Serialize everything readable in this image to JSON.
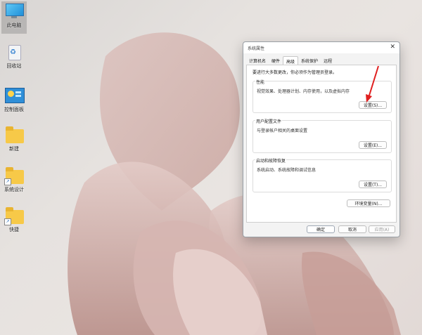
{
  "desktop": {
    "icons": [
      {
        "label": "此电脑"
      },
      {
        "label": "回收站"
      },
      {
        "label": "控制面板"
      },
      {
        "label": "新建"
      },
      {
        "label": "系统设计"
      },
      {
        "label": "快捷"
      }
    ]
  },
  "dialog": {
    "title": "系统属性",
    "close_glyph": "✕",
    "tabs": [
      "计算机名",
      "硬件",
      "高级",
      "系统保护",
      "远程"
    ],
    "active_tab": "高级",
    "notice": "要进行大多数更改，你必须作为管理员登录。",
    "groups": [
      {
        "title": "性能",
        "desc": "视觉效果、处理器计划、内存使用，以及虚拟内存",
        "button": "设置(S)..."
      },
      {
        "title": "用户配置文件",
        "desc": "与登录帐户相关的桌面设置",
        "button": "设置(E)..."
      },
      {
        "title": "启动和故障恢复",
        "desc": "系统启动、系统故障和调试信息",
        "button": "设置(T)..."
      }
    ],
    "env_button": "环境变量(N)...",
    "ok": "确定",
    "cancel": "取消",
    "apply": "应用(A)"
  },
  "colors": {
    "annotation_arrow": "#e02020",
    "folder": "#f7c948"
  }
}
